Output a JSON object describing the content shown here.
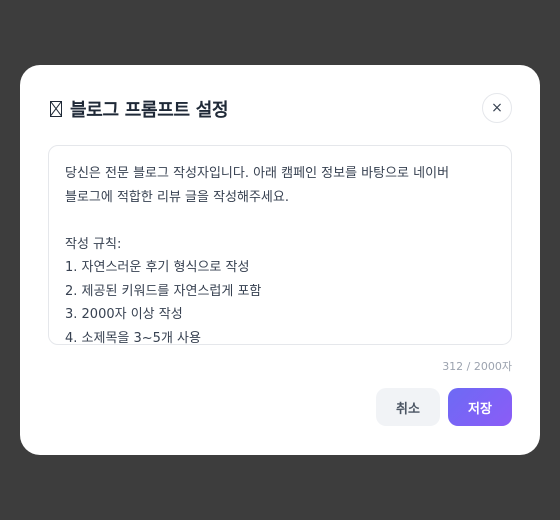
{
  "modal": {
    "title": "블로그 프롬프트 설정",
    "title_icon": "missing-glyph-icon",
    "close_label": "×",
    "textarea_value": "당신은 전문 블로그 작성자입니다. 아래 캠페인 정보를 바탕으로 네이버 블로그에 적합한 리뷰 글을 작성해주세요.\n\n작성 규칙:\n1. 자연스러운 후기 형식으로 작성\n2. 제공된 키워드를 자연스럽게 포함\n3. 2000자 이상 작성\n4. 소제목을 3~5개 사용",
    "char_count": "312 / 2000자",
    "cancel_label": "취소",
    "save_label": "저장",
    "colors": {
      "backdrop": "#3d3d3d",
      "primary": "#7c6ff6",
      "cancel_bg": "#f1f3f6"
    }
  }
}
